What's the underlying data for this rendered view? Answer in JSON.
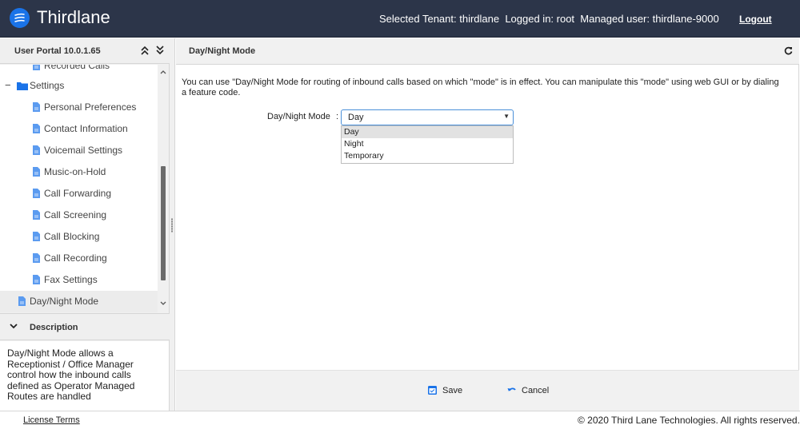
{
  "header": {
    "app_title": "Thirdlane",
    "logo_icon": "thirdlane-logo-icon",
    "session_info": "Selected Tenant: thirdlane  Logged in: root  Managed user: thirdlane-9000",
    "logout_label": "Logout"
  },
  "sidebar": {
    "title": "User Portal 10.0.1.65",
    "collapse_all_icon": "double-chevron-up-icon",
    "expand_all_icon": "double-chevron-down-icon",
    "tree": [
      {
        "label": "Recorded Calls",
        "type": "page",
        "level": 2,
        "partially_visible": true
      },
      {
        "label": "Settings",
        "type": "folder",
        "level": 1,
        "expanded": true
      },
      {
        "label": "Personal Preferences",
        "type": "page",
        "level": 2
      },
      {
        "label": "Contact Information",
        "type": "page",
        "level": 2
      },
      {
        "label": "Voicemail Settings",
        "type": "page",
        "level": 2
      },
      {
        "label": "Music-on-Hold",
        "type": "page",
        "level": 2
      },
      {
        "label": "Call Forwarding",
        "type": "page",
        "level": 2
      },
      {
        "label": "Call Screening",
        "type": "page",
        "level": 2
      },
      {
        "label": "Call Blocking",
        "type": "page",
        "level": 2
      },
      {
        "label": "Call Recording",
        "type": "page",
        "level": 2
      },
      {
        "label": "Fax Settings",
        "type": "page",
        "level": 2
      },
      {
        "label": "Day/Night Mode",
        "type": "page",
        "level": 1,
        "selected": true
      }
    ],
    "collapse_toggle": "−",
    "description": {
      "title": "Description",
      "text": "Day/Night Mode allows a Receptionist / Office Manager control how the inbound calls defined as Operator Managed Routes are handled"
    }
  },
  "main": {
    "title": "Day/Night Mode",
    "refresh_icon": "refresh-icon",
    "intro": "You can use \"Day/Night Mode for routing of inbound calls based on which \"mode\" is in effect. You can manipulate this \"mode\" using web GUI or by dialing a feature code.",
    "field": {
      "label": "Day/Night Mode",
      "separator": ":",
      "value": "Day",
      "options": [
        "Day",
        "Night",
        "Temporary"
      ],
      "highlighted_option": "Day"
    },
    "actions": {
      "save_label": "Save",
      "cancel_label": "Cancel"
    }
  },
  "footer": {
    "license_label": "License Terms",
    "copyright": "© 2020 Third Lane Technologies. All rights reserved."
  },
  "colors": {
    "topbar": "#2c3549",
    "accent": "#1a73e8",
    "icon_blue": "#5b9bf0"
  }
}
